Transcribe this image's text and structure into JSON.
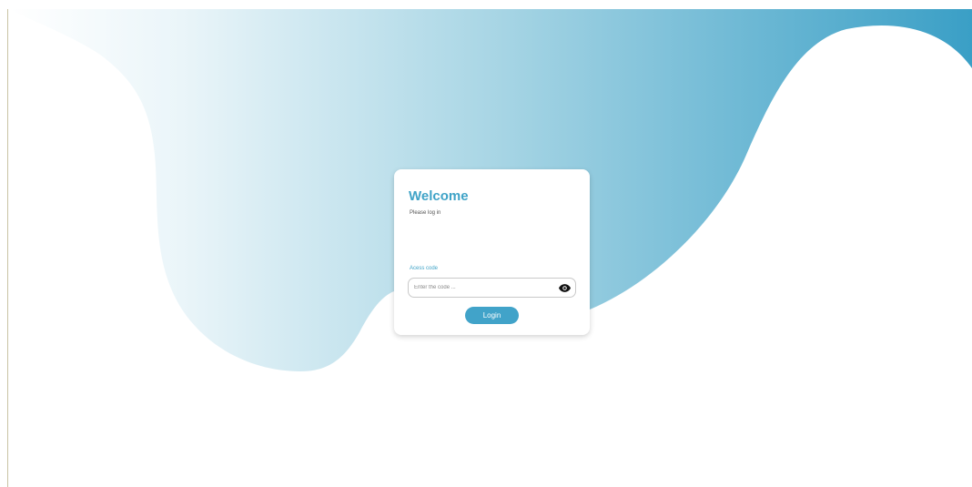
{
  "login_card": {
    "title": "Welcome",
    "subtitle": "Please log in",
    "access_code_label": "Acess code",
    "access_code_placeholder": "Enter the code ...",
    "access_code_value": "",
    "login_label": "Login"
  },
  "icons": {
    "visibility_toggle": "eye-icon"
  },
  "colors": {
    "accent": "#3fa3c7",
    "button": "#41a3c9",
    "gradient_start": "#ffffff",
    "gradient_end": "#3a9fc6"
  }
}
